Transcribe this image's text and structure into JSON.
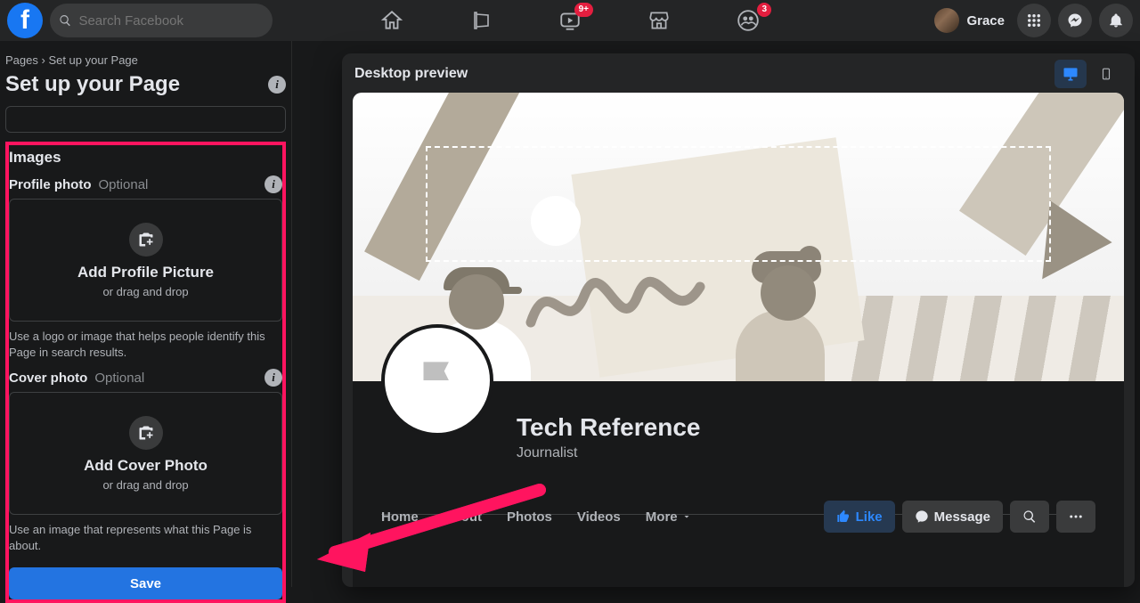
{
  "search": {
    "placeholder": "Search Facebook"
  },
  "nav_badges": {
    "watch": "9+",
    "groups": "3"
  },
  "user": {
    "name": "Grace"
  },
  "breadcrumb": {
    "root": "Pages",
    "sep": " › ",
    "current": "Set up your Page"
  },
  "page_title": "Set up your Page",
  "images": {
    "section": "Images",
    "profile": {
      "label": "Profile photo",
      "optional": "Optional",
      "dz_title": "Add Profile Picture",
      "dz_sub": "or drag and drop",
      "hint": "Use a logo or image that helps people identify this Page in search results."
    },
    "cover": {
      "label": "Cover photo",
      "optional": "Optional",
      "dz_title": "Add Cover Photo",
      "dz_sub": "or drag and drop",
      "hint": "Use an image that represents what this Page is about."
    }
  },
  "save": "Save",
  "preview": {
    "title": "Desktop preview",
    "page_name": "Tech Reference",
    "category": "Journalist",
    "tabs": {
      "home": "Home",
      "about": "About",
      "photos": "Photos",
      "videos": "Videos",
      "more": "More"
    },
    "actions": {
      "like": "Like",
      "message": "Message"
    }
  }
}
